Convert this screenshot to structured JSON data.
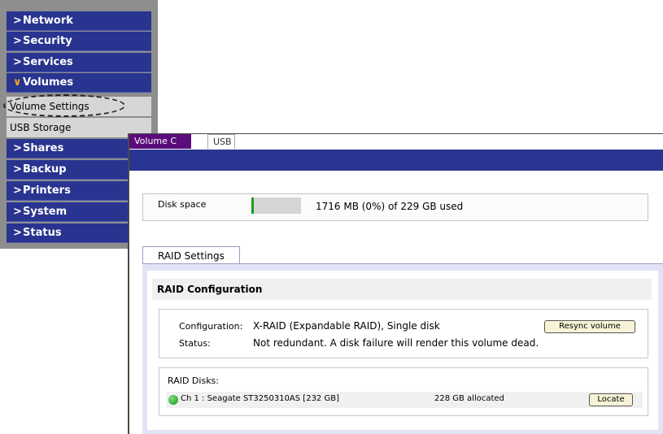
{
  "menu": {
    "items": [
      {
        "label": "Network",
        "icon": "chevron-right-icon"
      },
      {
        "label": "Security",
        "icon": "chevron-right-icon"
      },
      {
        "label": "Services",
        "icon": "chevron-right-icon"
      },
      {
        "label": "Volumes",
        "icon": "chevron-down-icon"
      },
      {
        "label": "Shares",
        "icon": "chevron-right-icon"
      },
      {
        "label": "Backup",
        "icon": "chevron-right-icon"
      },
      {
        "label": "Printers",
        "icon": "chevron-right-icon"
      },
      {
        "label": "System",
        "icon": "chevron-right-icon"
      },
      {
        "label": "Status",
        "icon": "chevron-right-icon"
      }
    ],
    "chevron_right": ">",
    "chevron_down": "∨",
    "subitems": [
      {
        "label": "Volume Settings"
      },
      {
        "label": "USB Storage"
      }
    ]
  },
  "panel": {
    "tabs": [
      {
        "label": "Volume C"
      },
      {
        "label": "USB"
      }
    ],
    "disk_space": {
      "label": "Disk space",
      "usage_fraction": 0.0,
      "text": "1716 MB (0%) of 229 GB used"
    },
    "raid_tab": "RAID Settings",
    "raid": {
      "header": "RAID Configuration",
      "config_label": "Configuration:",
      "config_value": "X-RAID (Expandable RAID), Single disk",
      "status_label": "Status:",
      "status_value": "Not redundant. A disk failure will render this volume dead.",
      "resync_button": "Resync volume",
      "disks_label": "RAID Disks:",
      "disks": [
        {
          "name": "Ch 1 : Seagate ST3250310AS [232 GB]",
          "allocated": "228 GB allocated",
          "status_color": "#22aa22",
          "button": "Locate"
        }
      ]
    }
  },
  "colors": {
    "menu_blue": "#28348f",
    "accent_orange": "#f7a21b",
    "tab_purple": "#5a0d7a",
    "raid_frame": "#e3e3f7"
  }
}
